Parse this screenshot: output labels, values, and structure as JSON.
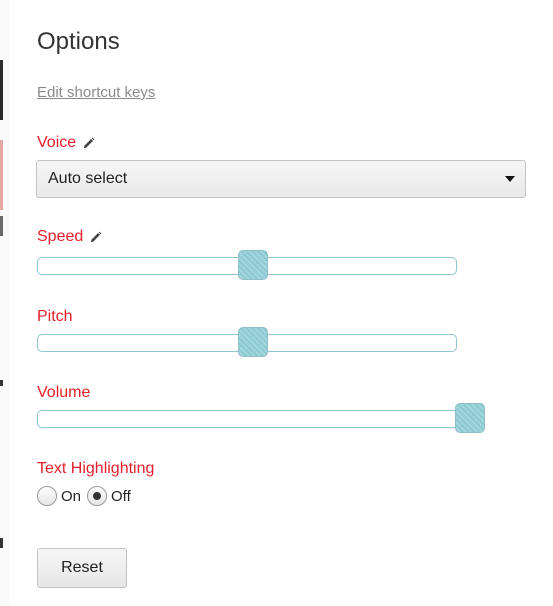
{
  "panel": {
    "title": "Options",
    "shortcut_link": "Edit shortcut keys"
  },
  "voice": {
    "label": "Voice",
    "selected": "Auto select"
  },
  "speed": {
    "label": "Speed",
    "level": 0.5
  },
  "pitch": {
    "label": "Pitch",
    "level": 0.5
  },
  "volume": {
    "label": "Volume",
    "level": 1.0
  },
  "text_highlighting": {
    "label": "Text Highlighting",
    "options": [
      {
        "label": "On",
        "checked": false
      },
      {
        "label": "Off",
        "checked": true
      }
    ]
  },
  "reset_label": "Reset",
  "colors": {
    "label_red": "#e5202b",
    "slider_border": "#8fc6cf",
    "slider_thumb": "#8ccad3"
  },
  "icons": {
    "edit": "pencil-icon",
    "dropdown": "caret-down-icon"
  }
}
